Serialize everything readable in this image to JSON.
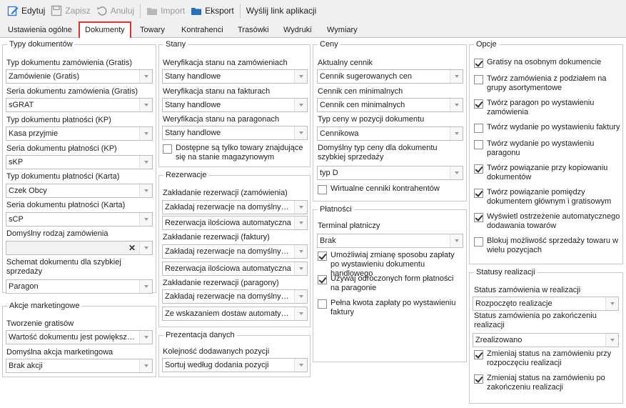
{
  "toolbar": {
    "edit": "Edytuj",
    "save": "Zapisz",
    "cancel": "Anuluj",
    "import": "Import",
    "export": "Eksport",
    "send_link": "Wyślij link aplikacji"
  },
  "colors": {
    "accent_tab_border": "#e03030",
    "folder": "#f2b233",
    "edit_icon": "#2f7bd0",
    "export_icon": "#2b6fb7"
  },
  "tabs": [
    "Ustawienia ogólne",
    "Dokumenty",
    "Towary",
    "Kontrahenci",
    "Trasówki",
    "Wydruki",
    "Wymiary"
  ],
  "typy": {
    "legend": "Typy dokumentów",
    "l1": "Typ dokumentu zamówienia (Gratis)",
    "v1": "Zamówienie (Gratis)",
    "l2": "Seria dokumentu zamówienia (Gratis)",
    "v2": "sGRAT",
    "l3": "Typ dokumentu płatności (KP)",
    "v3": "Kasa przyjmie",
    "l4": "Seria dokumentu płatności (KP)",
    "v4": "sKP",
    "l5": "Typ dokumentu płatności (Karta)",
    "v5": "Czek Obcy",
    "l6": "Seria dokumentu płatności (Karta)",
    "v6": "sCP",
    "l7": "Domyślny rodzaj zamówienia",
    "v7": "",
    "l8": "Schemat dokumentu dla szybkiej sprzedaży",
    "v8": "Paragon"
  },
  "akcje": {
    "legend": "Akcje marketingowe",
    "l1": "Tworzenie gratisów",
    "v1": "Wartość dokumentu jest powiększa...",
    "l2": "Domyślna akcja marketingowa",
    "v2": "Brak akcji"
  },
  "stany": {
    "legend": "Stany",
    "l1": "Weryfikacja stanu na zamówieniach",
    "v1": "Stany handlowe",
    "l2": "Weryfikacja stanu na fakturach",
    "v2": "Stany handlowe",
    "l3": "Weryfikacja stanu na paragonach",
    "v3": "Stany handlowe",
    "chk1": "Dostępne są tylko towary znajdujące się na stanie magazynowym"
  },
  "rezerwacje": {
    "legend": "Rezerwacje",
    "l1": "Zakładanie rezerwacji (zamówienia)",
    "v1a": "Zakładaj rezerwacje na domyślnym ...",
    "v1b": "Rezerwacja ilościowa automatyczna",
    "l2": "Zakładanie rezerwacji (faktury)",
    "v2a": "Zakładaj rezerwacje na domyślnym ...",
    "v2b": "Rezerwacja ilościowa automatyczna",
    "l3": "Zakładanie rezerwacji (paragony)",
    "v3a": "Zakładaj rezerwacje na domyślnym ...",
    "v3b": "Ze wskazaniem dostaw automatycz..."
  },
  "prezentacja": {
    "legend": "Prezentacja danych",
    "l1": "Kolejność dodawanych pozycji",
    "v1": "Sortuj według dodania pozycji"
  },
  "ceny": {
    "legend": "Ceny",
    "l1": "Aktualny cennik",
    "v1": "Cennik sugerowanych cen",
    "l2": "Cennik cen minimalnych",
    "v2": "Cennik cen minimalnych",
    "l3": "Typ ceny w pozycji dokumentu",
    "v3": "Cennikowa",
    "l4": "Domyślny typ ceny dla dokumentu szybkiej sprzedaży",
    "v4": "typ D",
    "chk1": "Wirtualne cenniki kontrahentów"
  },
  "platnosci": {
    "legend": "Płatności",
    "l1": "Terminal płatniczy",
    "v1": "Brak",
    "chk1": "Umożliwiaj zmianę sposobu zapłaty po wystawieniu dokumentu handlowego",
    "chk2": "Używaj odroczonych form płatności na paragonie",
    "chk3": "Pełna kwota zapłaty po wystawieniu faktury"
  },
  "opcje": {
    "legend": "Opcje",
    "items": [
      {
        "label": "Gratisy na osobnym dokumencie",
        "checked": true
      },
      {
        "label": "Twórz zamówienia z podziałem na grupy asortymentowe",
        "checked": false
      },
      {
        "label": "Twórz paragon po wystawieniu zamówienia",
        "checked": true
      },
      {
        "label": "Twórz wydanie po wystawieniu faktury",
        "checked": false
      },
      {
        "label": "Twórz wydanie po wystawieniu paragonu",
        "checked": false
      },
      {
        "label": "Twórz powiązanie przy kopiowaniu dokumentów",
        "checked": true
      },
      {
        "label": "Twórz powiązanie pomiędzy dokumentem głównym i gratisowym",
        "checked": true
      },
      {
        "label": "Wyświetl ostrzeżenie automatycznego dodawania towarów",
        "checked": true
      },
      {
        "label": "Blokuj możliwość sprzedaży towaru w wielu pozycjach",
        "checked": false
      }
    ]
  },
  "statusy": {
    "legend": "Statusy realizacji",
    "l1": "Status zamówienia w realizacji",
    "v1": "Rozpoczęto realizacje",
    "l2": "Status zamówienia po zakończeniu realizacji",
    "v2": "Zrealizowano",
    "chk1": "Zmieniaj status na zamówieniu przy rozpoczęciu realizacji",
    "chk2": "Zmieniaj status na zamówieniu po zakończeniu realizacji"
  }
}
